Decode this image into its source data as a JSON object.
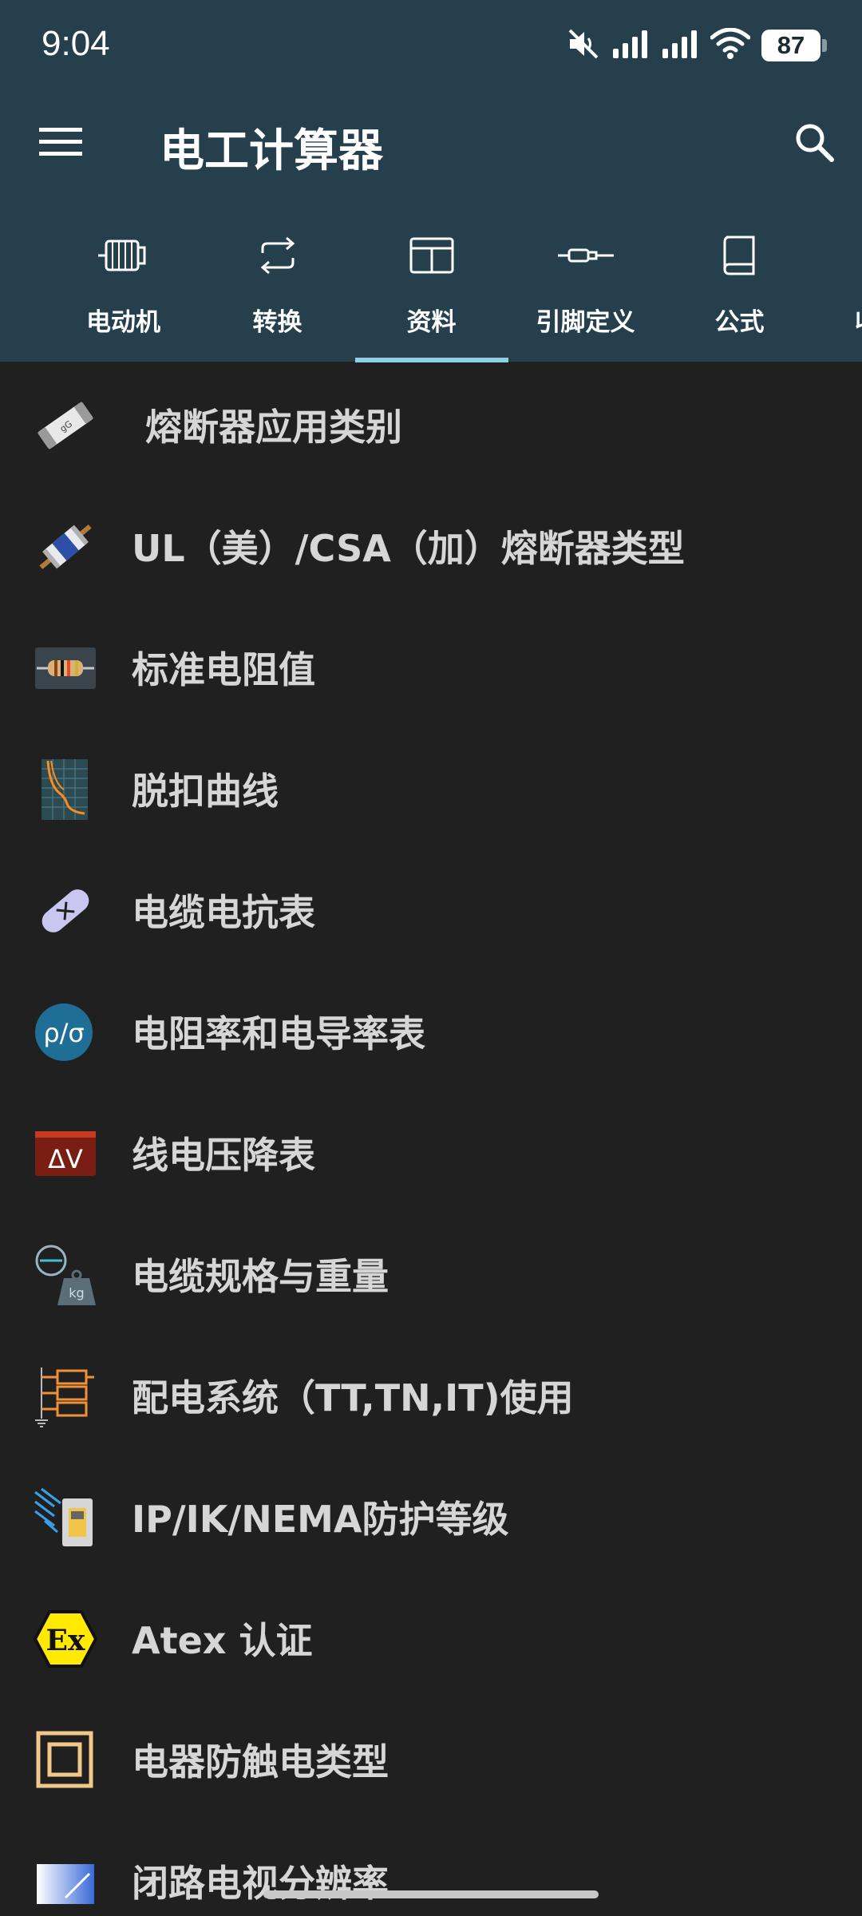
{
  "status_bar": {
    "time": "9:04",
    "battery_level": "87",
    "icons": [
      "mute-icon",
      "signal-icon",
      "signal-icon",
      "wifi-icon",
      "battery-icon"
    ]
  },
  "app_bar": {
    "title": "电工计算器",
    "menu_icon": "menu-icon",
    "search_icon": "search-icon"
  },
  "tabs": [
    {
      "label": "电动机",
      "icon": "motor-icon",
      "selected": false
    },
    {
      "label": "转换",
      "icon": "convert-icon",
      "selected": false
    },
    {
      "label": "资料",
      "icon": "table-icon",
      "selected": true
    },
    {
      "label": "引脚定义",
      "icon": "connector-icon",
      "selected": false
    },
    {
      "label": "公式",
      "icon": "book-icon",
      "selected": false
    },
    {
      "label": "收",
      "icon": "",
      "selected": false
    }
  ],
  "list": {
    "items": [
      {
        "label": "熔断器应用类别",
        "icon": "fuse-icon"
      },
      {
        "label": "UL（美）/CSA（加）熔断器类型",
        "icon": "ul-fuse-icon"
      },
      {
        "label": "标准电阻值",
        "icon": "resistor-icon"
      },
      {
        "label": "脱扣曲线",
        "icon": "trip-curve-icon"
      },
      {
        "label": "电缆电抗表",
        "icon": "cable-reactance-icon"
      },
      {
        "label": "电阻率和电导率表",
        "icon": "resistivity-icon",
        "icon_text": "ρ/σ"
      },
      {
        "label": "线电压降表",
        "icon": "voltage-drop-icon",
        "icon_text": "ΔV"
      },
      {
        "label": "电缆规格与重量",
        "icon": "cable-weight-icon",
        "icon_text": "kg"
      },
      {
        "label": "配电系统（TT,TN,IT)使用",
        "icon": "distribution-system-icon"
      },
      {
        "label": "IP/IK/NEMA防护等级",
        "icon": "protection-rating-icon"
      },
      {
        "label": "Atex 认证",
        "icon": "atex-icon",
        "icon_text": "Ex"
      },
      {
        "label": "电器防触电类型",
        "icon": "shock-protection-icon"
      },
      {
        "label": "闭路电视分辨率",
        "icon": "cctv-resolution-icon"
      }
    ]
  },
  "colors": {
    "header_bg": "#263f4d",
    "list_bg": "#202020",
    "tab_indicator": "#8fd0e4",
    "text_primary": "#d6d6d6"
  }
}
